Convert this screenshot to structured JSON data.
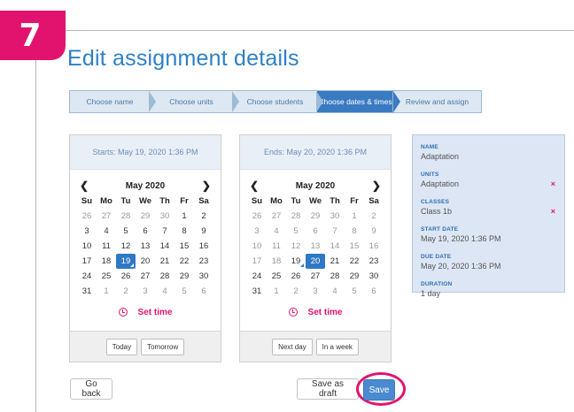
{
  "step_number": "7",
  "page_title": "Edit assignment details",
  "stepper": [
    {
      "label": "Choose name",
      "active": false
    },
    {
      "label": "Choose units",
      "active": false
    },
    {
      "label": "Choose students",
      "active": false
    },
    {
      "label": "Choose dates & times",
      "active": true
    },
    {
      "label": "Review and assign",
      "active": false
    }
  ],
  "weekday_headers": [
    "Su",
    "Mo",
    "Tu",
    "We",
    "Th",
    "Fr",
    "Sa"
  ],
  "start_calendar": {
    "header": "Starts: May 19, 2020 1:36 PM",
    "month_label": "May 2020",
    "prev_icon": "chevron-left-icon",
    "next_icon": "chevron-right-icon",
    "weeks": [
      [
        "26",
        "27",
        "28",
        "29",
        "30",
        "1",
        "2"
      ],
      [
        "3",
        "4",
        "5",
        "6",
        "7",
        "8",
        "9"
      ],
      [
        "10",
        "11",
        "12",
        "13",
        "14",
        "15",
        "16"
      ],
      [
        "17",
        "18",
        "19",
        "20",
        "21",
        "22",
        "23"
      ],
      [
        "24",
        "25",
        "26",
        "27",
        "28",
        "29",
        "30"
      ],
      [
        "31",
        "1",
        "2",
        "3",
        "4",
        "5",
        "6"
      ]
    ],
    "selected_day": "19",
    "today_day": "19",
    "set_time_label": "Set time",
    "quick_buttons": [
      "Today",
      "Tomorrow"
    ]
  },
  "end_calendar": {
    "header": "Ends: May 20, 2020 1:36 PM",
    "month_label": "May 2020",
    "prev_icon": "chevron-left-icon",
    "next_icon": "chevron-right-icon",
    "weeks": [
      [
        "26",
        "27",
        "28",
        "29",
        "30",
        "1",
        "2"
      ],
      [
        "3",
        "4",
        "5",
        "6",
        "7",
        "8",
        "9"
      ],
      [
        "10",
        "11",
        "12",
        "13",
        "14",
        "15",
        "16"
      ],
      [
        "17",
        "18",
        "19",
        "20",
        "21",
        "22",
        "23"
      ],
      [
        "24",
        "25",
        "26",
        "27",
        "28",
        "29",
        "30"
      ],
      [
        "31",
        "1",
        "2",
        "3",
        "4",
        "5",
        "6"
      ]
    ],
    "selected_day": "20",
    "today_day": "19",
    "disabled_before_day": "19",
    "set_time_label": "Set time",
    "quick_buttons": [
      "Next day",
      "In a week"
    ]
  },
  "summary": {
    "name_label": "NAME",
    "name_value": "Adaptation",
    "units_label": "UNITS",
    "units_value": "Adaptation",
    "classes_label": "CLASSES",
    "classes_value": "Class 1b",
    "start_label": "START DATE",
    "start_value": "May 19, 2020 1:36 PM",
    "due_label": "DUE DATE",
    "due_value": "May 20, 2020 1:36 PM",
    "duration_label": "DURATION",
    "duration_value": "1 day",
    "remove_glyph": "×"
  },
  "footer": {
    "go_back_label": "Go back",
    "draft_label": "Save as draft",
    "save_label": "Save"
  },
  "colors": {
    "accent_magenta": "#e2136e",
    "primary_blue": "#2e78c6",
    "title_blue": "#2e80c5"
  }
}
